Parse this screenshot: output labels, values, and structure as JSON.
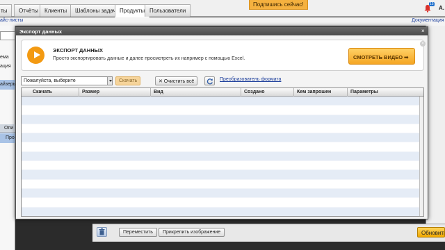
{
  "nav": {
    "tabs": [
      {
        "label": "ты"
      },
      {
        "label": "Отчёты"
      },
      {
        "label": "Клиенты"
      },
      {
        "label": "Шаблоны задач"
      },
      {
        "label": "Продукты"
      },
      {
        "label": "Пользователи"
      }
    ],
    "active_tab": "Продукты",
    "subscribe_label": "Подпишись сейчас!",
    "notification_count": "15",
    "user_initial": "A.",
    "sub_left_link": "айс-листы",
    "sub_right_link": "Документация"
  },
  "left_panel": {
    "items": [
      "",
      "ема",
      "ация",
      "айзеры"
    ],
    "table_header": "Опи",
    "selected_row": "Про"
  },
  "modal": {
    "title": "Экспорт данных",
    "close_symbol": "×",
    "promo": {
      "heading": "ЭКСПОРТ ДАННЫХ",
      "text": "Просто экспортировать данные и далее просмотреть их например с помощью Excel.",
      "watch_button": "СМОТРЕТЬ ВИДЕО ➡",
      "close_symbol": "×"
    },
    "toolbar": {
      "select_value": "Пожалуйста, выберите",
      "download_label": "Скачать",
      "clear_all_label": "✕ Очистить всё",
      "format_converter_link": "Преобразователь формата"
    },
    "grid": {
      "columns": [
        "Скачать",
        "Размер",
        "Вид",
        "Создано",
        "Кем запрошен",
        "Параметры"
      ]
    }
  },
  "bottom_bar": {
    "move_label": "Переместить",
    "attach_image_label": "Прикрепить изображение",
    "refresh_label": "Обновить"
  },
  "colors": {
    "accent_orange": "#f39a12",
    "link_blue": "#1a3c9a",
    "grid_alt_row": "#e5ecf6",
    "modal_title_bar": "#4a4a4a"
  }
}
